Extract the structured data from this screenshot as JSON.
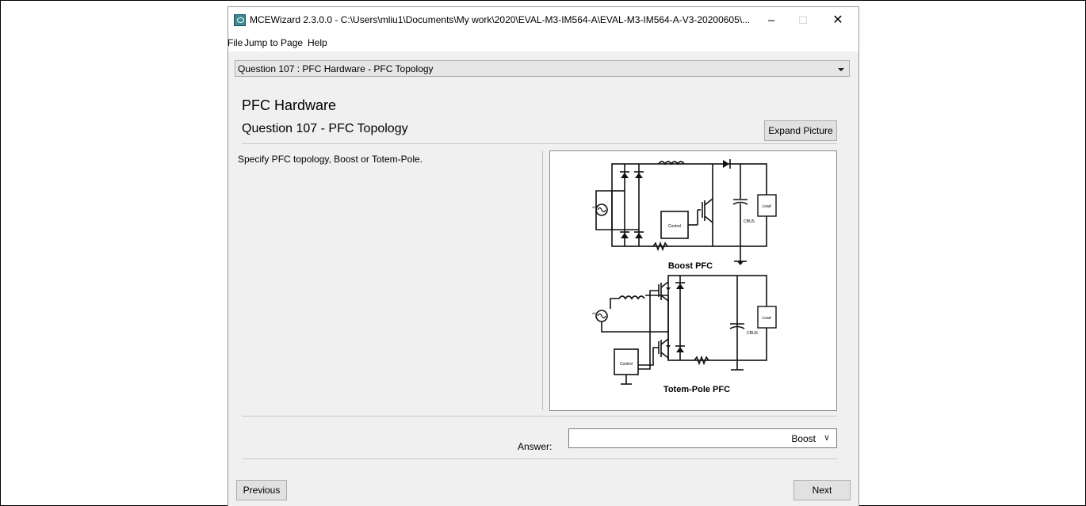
{
  "window": {
    "title": "MCEWizard 2.3.0.0  - C:\\Users\\mliu1\\Documents\\My work\\2020\\EVAL-M3-IM564-A\\EVAL-M3-IM564-A-V3-20200605\\...",
    "minimize_glyph": "–",
    "maximize_glyph": "☐",
    "close_glyph": "✕"
  },
  "menu": {
    "items": [
      "File",
      "Jump to Page",
      "Help"
    ]
  },
  "page_selector": {
    "value": "Question  107 : PFC Hardware - PFC Topology"
  },
  "content": {
    "section_title": "PFC Hardware",
    "question_title": "Question 107 - PFC Topology",
    "expand_button": "Expand Picture",
    "question_text": "Specify PFC topology, Boost or Totem-Pole."
  },
  "diagram": {
    "boost_caption": "Boost PFC",
    "totem_caption": "Totem-Pole PFC",
    "control_label": "Control",
    "load_label": "Load",
    "cbus_label": "CBUS",
    "ac_label": "AC"
  },
  "answer": {
    "label": "Answer:",
    "value": "Boost",
    "chevron": "∨"
  },
  "navigation": {
    "previous": "Previous",
    "next": "Next"
  }
}
